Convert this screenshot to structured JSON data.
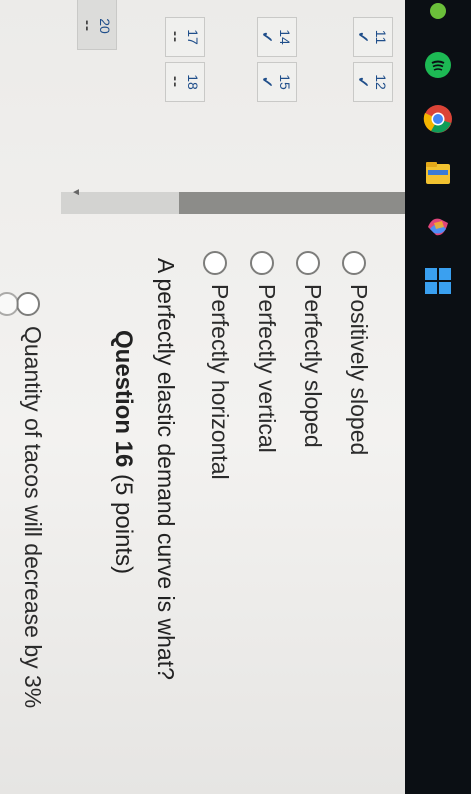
{
  "question_nav": {
    "items": [
      {
        "num": "11",
        "mark": "✓"
      },
      {
        "num": "12",
        "mark": "✓"
      },
      {
        "num": "14",
        "mark": "✓"
      },
      {
        "num": "15",
        "mark": "✓"
      },
      {
        "num": "17",
        "mark": "--"
      },
      {
        "num": "18",
        "mark": "--"
      },
      {
        "num": "20",
        "mark": "--"
      }
    ],
    "progress_arrow": "▸"
  },
  "previous_option": {
    "label": "Quantity of tacos will decrease by 3%"
  },
  "question": {
    "title": "Question 16",
    "points": "(5 points)",
    "prompt": "A perfectly elastic demand curve is what?",
    "options": [
      {
        "label": "Perfectly horizontal"
      },
      {
        "label": "Perfectly vertical"
      },
      {
        "label": "Perfectly sloped"
      },
      {
        "label": "Positively sloped"
      }
    ]
  },
  "taskbar": {
    "icons": [
      "windows-start-icon",
      "copilot-icon",
      "file-explorer-icon",
      "chrome-icon",
      "spotify-icon",
      "tray-icon"
    ]
  },
  "colors": {
    "accent": "#1f4e8a",
    "taskbar": "#0b0f14"
  }
}
